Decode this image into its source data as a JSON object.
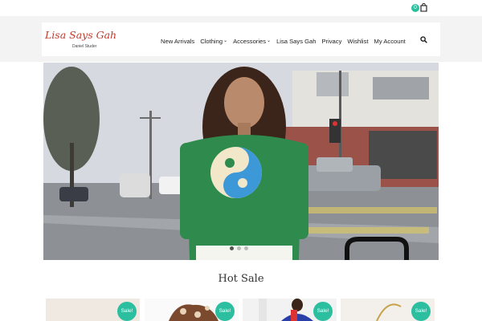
{
  "cart": {
    "count": "0",
    "icon": "shopping-bag-icon"
  },
  "logo": {
    "title": "Lisa Says Gah",
    "subtitle": "Daniel Studer"
  },
  "nav": {
    "items": [
      {
        "label": "New Arrivals",
        "dropdown": false
      },
      {
        "label": "Clothing",
        "dropdown": true
      },
      {
        "label": "Accessories",
        "dropdown": true
      },
      {
        "label": "Lisa Says Gah",
        "dropdown": false
      },
      {
        "label": "Privacy",
        "dropdown": false
      },
      {
        "label": "Wishlist",
        "dropdown": false
      },
      {
        "label": "My Account",
        "dropdown": false
      }
    ],
    "search_icon": "search-icon"
  },
  "hero": {
    "slides": 3,
    "active_slide": 1
  },
  "hot_sale": {
    "title": "Hot Sale",
    "products": [
      {
        "badge": "Sale!"
      },
      {
        "badge": "Sale!"
      },
      {
        "badge": "Sale!"
      },
      {
        "badge": "Sale!"
      }
    ]
  },
  "colors": {
    "accent": "#2bbfa0",
    "logo": "#c0392b",
    "header_band": "#f3f3f3"
  }
}
